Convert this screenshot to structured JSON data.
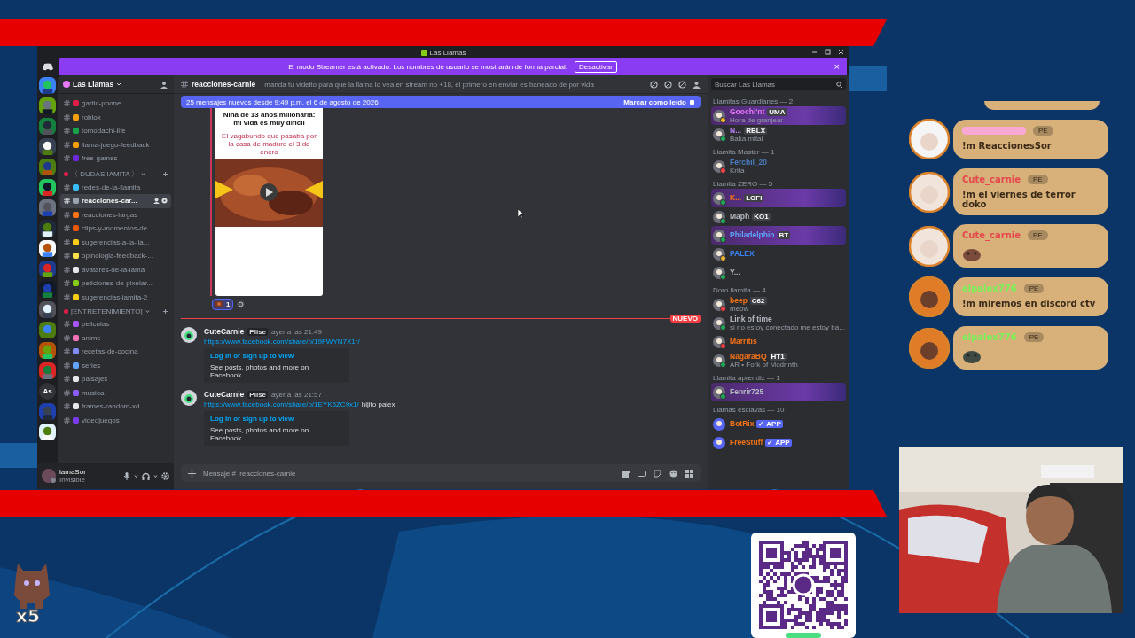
{
  "window": {
    "title": "Las Llamas"
  },
  "banner": {
    "text": "El modo Streamer está activado. Los nombres de usuario se mostrarán de forma parcial.",
    "button": "Desactivar",
    "close": "×"
  },
  "server_rail": {
    "text_icon": "As"
  },
  "sidebar": {
    "server_name": "Las Llamas",
    "sections": [
      {
        "channels": [
          {
            "name": "gartic-phone",
            "color": "#e11d48",
            "selected": false
          },
          {
            "name": "roblox",
            "color": "#f59e0b",
            "selected": false
          },
          {
            "name": "tomodachi-life",
            "color": "#16a34a",
            "selected": false
          },
          {
            "name": "llama-juego-feedback",
            "color": "#f59e0b",
            "selected": false
          },
          {
            "name": "free-games",
            "color": "#6d28d9",
            "selected": false
          }
        ]
      },
      {
        "category": "〈 DUDAS IAMITA 〉",
        "channels": [
          {
            "name": "redes-de-la-llamita",
            "color": "#38bdf8",
            "selected": false
          },
          {
            "name": "reacciones-car...",
            "color": "#9ca3af",
            "selected": true
          },
          {
            "name": "reacciones-largas",
            "color": "#f97316",
            "selected": false
          },
          {
            "name": "clips-y-momentos-de...",
            "color": "#ea580c",
            "selected": false
          },
          {
            "name": "sugerencias-a-la-lla...",
            "color": "#facc15",
            "selected": false
          },
          {
            "name": "opinologia-feedback-...",
            "color": "#fde047",
            "selected": false
          },
          {
            "name": "avatares-de-la-iama",
            "color": "#e5e7eb",
            "selected": false
          },
          {
            "name": "peticiones-de-pixelar...",
            "color": "#84cc16",
            "selected": false
          },
          {
            "name": "sugerencias-iamita-2",
            "color": "#facc15",
            "selected": false
          }
        ]
      },
      {
        "category": "[ENTRETENIMIENTO]",
        "channels": [
          {
            "name": "peliculas",
            "color": "#a855f7",
            "selected": false
          },
          {
            "name": "anime",
            "color": "#f472b6",
            "selected": false
          },
          {
            "name": "recetas-de-cocina",
            "color": "#818cf8",
            "selected": false
          },
          {
            "name": "series",
            "color": "#60a5fa",
            "selected": false
          },
          {
            "name": "paisajes",
            "color": "#e5e7eb",
            "selected": false
          },
          {
            "name": "musica",
            "color": "#8b5cf6",
            "selected": false
          },
          {
            "name": "frames-random-xd",
            "color": "#e5e7eb",
            "selected": false
          },
          {
            "name": "videojuegos",
            "color": "#7c3aed",
            "selected": false
          }
        ]
      }
    ]
  },
  "user_panel": {
    "name": "lamaSor",
    "status": "Invisible"
  },
  "channel_header": {
    "name": "reacciones-carnie",
    "topic": "manda tu videito para que la llama lo vea en stream no +18, el primero en enviar es baneado de por vida"
  },
  "new_messages": {
    "text": "25 mensajes nuevos desde 9:49 p.m. el 6 de agosto de 2026",
    "action": "Marcar como leído"
  },
  "video_embed": {
    "title": "Niña de 13 años millonaria: mi vida es muy difícil",
    "caption": "El vagabundo que pasaba por la casa de maduro el 3 de enero"
  },
  "reaction": {
    "count": "1"
  },
  "unread_divider": "NUEVO",
  "messages": [
    {
      "author": "CuteCarnie",
      "tag": "Plise",
      "time": "ayer a las 21:49",
      "link": "https://www.facebook.com/share/p/19FWYN7X1r/",
      "embed_title": "Log in or sign up to view",
      "embed_text": "See posts, photos and more on Facebook."
    },
    {
      "author": "CuteCarnie",
      "tag": "Plise",
      "time": "ayer a las 21:57",
      "link": "https://www.facebook.com/share/p/1EYK5ZC9x1/",
      "text": "hijito palex",
      "embed_title": "Log in or sign up to view",
      "embed_text": "See posts, photos and more on Facebook."
    }
  ],
  "composer": {
    "placeholder": "Mensaje #  reacciones-carnie"
  },
  "members": {
    "search_placeholder": "Buscar Las Llamas",
    "groups": [
      {
        "title": "Llamitas Guardianes — 2",
        "members": [
          {
            "name": "Goochi'nt",
            "tag": "UMA",
            "activity": "Hora de granjear",
            "color": "#e879f9",
            "presence": {
              "color": "#f0b232"
            },
            "highlight": true
          },
          {
            "name": "N...",
            "tag": "RBLX",
            "activity": "Baka mitai",
            "color": "#c084fc",
            "presence": {
              "color": "#23a55a"
            },
            "highlight": false
          }
        ]
      },
      {
        "title": "Llamita Master — 1",
        "members": [
          {
            "name": "Ferchil_20",
            "activity": "Krita",
            "color": "#4b7bbd",
            "presence": {
              "color": "#f23f43"
            },
            "highlight": false
          }
        ]
      },
      {
        "title": "Llamita ZERO — 5",
        "members": [
          {
            "name": "K...",
            "tag": "LOFI",
            "color": "#f97316",
            "presence": {
              "color": "#23a55a"
            },
            "highlight": true
          },
          {
            "name": "Maph",
            "tag": "KO1",
            "color": "#b5bac1",
            "presence": {
              "color": "#23a55a"
            },
            "highlight": false
          },
          {
            "name": "Philadelphio",
            "tag": "BT",
            "color": "#60a5fa",
            "presence": {
              "color": "#23a55a"
            },
            "highlight": true
          },
          {
            "name": "PALEX",
            "color": "#3b82f6",
            "presence": {
              "color": "#f0b232"
            },
            "highlight": false
          },
          {
            "name": "Y...",
            "color": "#b5bac1",
            "presence": {
              "color": "#23a55a"
            },
            "highlight": false
          }
        ]
      },
      {
        "title": "Doro llamita — 4",
        "members": [
          {
            "name": "beep",
            "tag": "C62",
            "activity": "meow",
            "color": "#f97316",
            "presence": {
              "color": "#f23f43"
            },
            "highlight": false
          },
          {
            "name": "Link of time",
            "activity": "si no estoy conectado me estoy ba...",
            "color": "#b5bac1",
            "presence": {
              "color": "#23a55a"
            },
            "highlight": false
          },
          {
            "name": "Marritis",
            "color": "#f97316",
            "presence": {
              "color": "#f23f43"
            },
            "highlight": false
          },
          {
            "name": "NagaraBQ",
            "tag": "HT1",
            "activity": "AR • Fork of Modrinth",
            "color": "#f97316",
            "presence": {
              "color": "#23a55a"
            },
            "highlight": false
          }
        ]
      },
      {
        "title": "Llamita aprendiz — 1",
        "members": [
          {
            "name": "Fenrir725",
            "color": "#b5bac1",
            "presence": {
              "color": "#23a55a"
            },
            "highlight": true
          }
        ]
      },
      {
        "title": "Llamas esclavas — 10",
        "members": [
          {
            "name": "BotRix",
            "tag": "✓ APP",
            "kind": "app",
            "color": "#f97316",
            "highlight": false
          },
          {
            "name": "FreeStuff",
            "tag": "✓ APP",
            "kind": "app",
            "color": "#f97316",
            "highlight": false
          }
        ]
      }
    ]
  },
  "stream_chat": [
    {
      "color": "#f9a8d4",
      "badge": "PE",
      "text": "!m ReaccionesSor",
      "kind": "text"
    },
    {
      "user": "Cute_carnie",
      "color": "#e5484d",
      "badge": "PE",
      "text": "!m el viernes de terror doko",
      "kind": "text"
    },
    {
      "user": "Cute_carnie",
      "color": "#e5484d",
      "badge": "PE",
      "kind": "emote"
    },
    {
      "user": "elpalex776",
      "color": "#7cf05a",
      "badge": "PE",
      "text": "!m miremos en discord ctv",
      "kind": "text"
    },
    {
      "user": "elpalex776",
      "color": "#7cf05a",
      "badge": "PE",
      "kind": "emote"
    }
  ],
  "multiplier": "x5"
}
